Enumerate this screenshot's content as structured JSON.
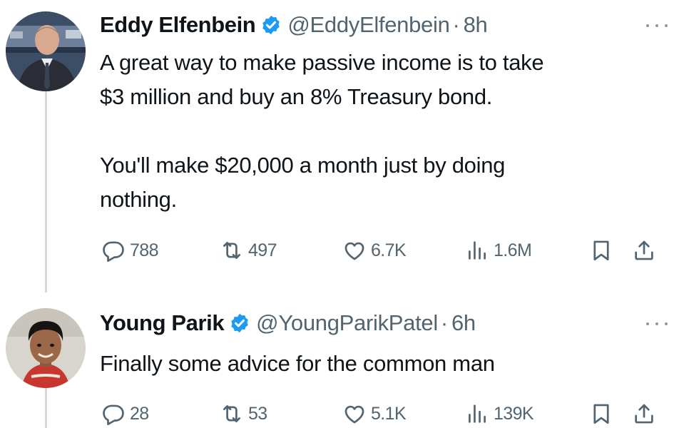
{
  "tweets": [
    {
      "author": {
        "name": "Eddy Elfenbein",
        "handle": "@EddyElfenbein",
        "verified": true,
        "time": "8h"
      },
      "text": "A great way to make passive income is to take\n$3 million and buy an 8% Treasury bond.\n\nYou'll make $20,000 a month just by doing\nnothing.",
      "stats": {
        "replies": "788",
        "reposts": "497",
        "likes": "6.7K",
        "views": "1.6M"
      }
    },
    {
      "author": {
        "name": "Young Parik",
        "handle": "@YoungParikPatel",
        "verified": true,
        "time": "6h"
      },
      "text": "Finally some advice for the common man",
      "stats": {
        "replies": "28",
        "reposts": "53",
        "likes": "5.1K",
        "views": "139K"
      }
    }
  ],
  "separator": "·",
  "icons": {
    "verified": "verified-badge-icon",
    "more": "more-icon",
    "reply": "reply-icon",
    "repost": "repost-icon",
    "like": "like-icon",
    "views": "views-icon",
    "bookmark": "bookmark-icon",
    "share": "share-icon"
  },
  "colors": {
    "text": "#0f1419",
    "muted": "#536471",
    "verified": "#1d9bf0",
    "thread_line": "#cfd9de",
    "background": "#ffffff"
  }
}
